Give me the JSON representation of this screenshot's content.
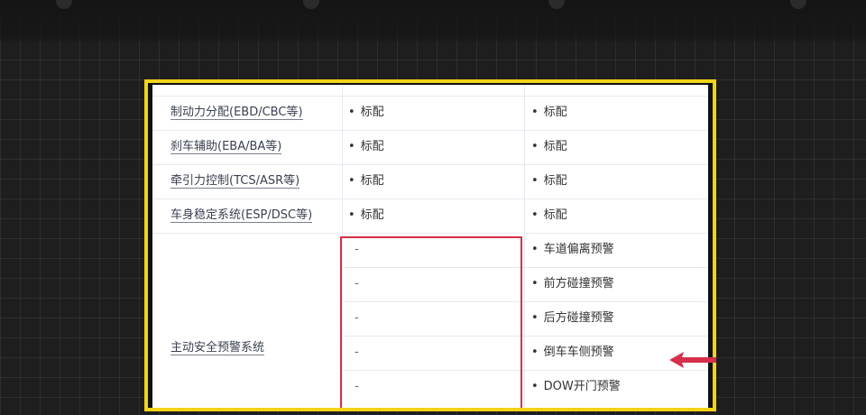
{
  "table": {
    "partial_top_row": {
      "label": "",
      "col2": "",
      "col3": ""
    },
    "rows": [
      {
        "label": "制动力分配(EBD/CBC等)",
        "col2": "标配",
        "col3": "标配"
      },
      {
        "label": "刹车辅助(EBA/BA等)",
        "col2": "标配",
        "col3": "标配"
      },
      {
        "label": "牵引力控制(TCS/ASR等)",
        "col2": "标配",
        "col3": "标配"
      },
      {
        "label": "车身稳定系统(ESP/DSC等)",
        "col2": "标配",
        "col3": "标配"
      }
    ],
    "merged_group": {
      "label": "主动安全预警系统",
      "col2": [
        "-",
        "-",
        "-",
        "-",
        "-"
      ],
      "col3": [
        "车道偏离预警",
        "前方碰撞预警",
        "后方碰撞预警",
        "倒车车侧预警",
        "DOW开门预警"
      ]
    },
    "bullet": "•"
  },
  "colors": {
    "frame": "#f2d318",
    "highlight_box": "#d6304a",
    "arrow": "#d6304a"
  },
  "icons": {
    "pointer": "left-arrow-icon"
  }
}
